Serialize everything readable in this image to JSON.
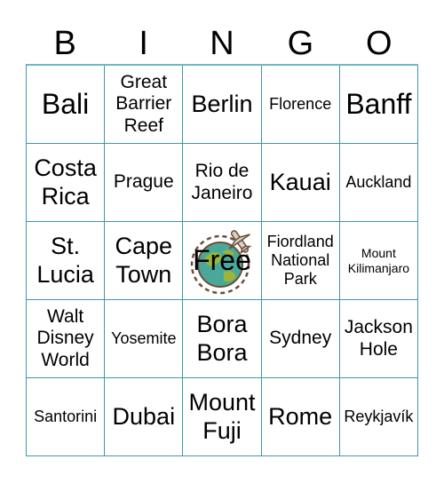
{
  "header": {
    "letters": [
      "B",
      "I",
      "N",
      "G",
      "O"
    ]
  },
  "cells": [
    {
      "text": "Bali",
      "size": "s-xl"
    },
    {
      "text": "Great Barrier Reef",
      "size": "s-m"
    },
    {
      "text": "Berlin",
      "size": "s-l"
    },
    {
      "text": "Florence",
      "size": "s-s"
    },
    {
      "text": "Banff",
      "size": "s-xl"
    },
    {
      "text": "Costa Rica",
      "size": "s-l"
    },
    {
      "text": "Prague",
      "size": "s-m"
    },
    {
      "text": "Rio de Janeiro",
      "size": "s-m"
    },
    {
      "text": "Kauai",
      "size": "s-l"
    },
    {
      "text": "Auckland",
      "size": "s-s"
    },
    {
      "text": "St. Lucia",
      "size": "s-l"
    },
    {
      "text": "Cape Town",
      "size": "s-l"
    },
    {
      "text": "Free",
      "size": "free",
      "icon": "globe-airplane-icon"
    },
    {
      "text": "Fiordland National Park",
      "size": "s-s"
    },
    {
      "text": "Mount Kilimanjaro",
      "size": "s-xs"
    },
    {
      "text": "Walt Disney World",
      "size": "s-m"
    },
    {
      "text": "Yosemite",
      "size": "s-s"
    },
    {
      "text": "Bora Bora",
      "size": "s-l"
    },
    {
      "text": "Sydney",
      "size": "s-m"
    },
    {
      "text": "Jackson Hole",
      "size": "s-m"
    },
    {
      "text": "Santorini",
      "size": "s-s"
    },
    {
      "text": "Dubai",
      "size": "s-l"
    },
    {
      "text": "Mount Fuji",
      "size": "s-l"
    },
    {
      "text": "Rome",
      "size": "s-l"
    },
    {
      "text": "Reykjavík",
      "size": "s-s"
    }
  ]
}
